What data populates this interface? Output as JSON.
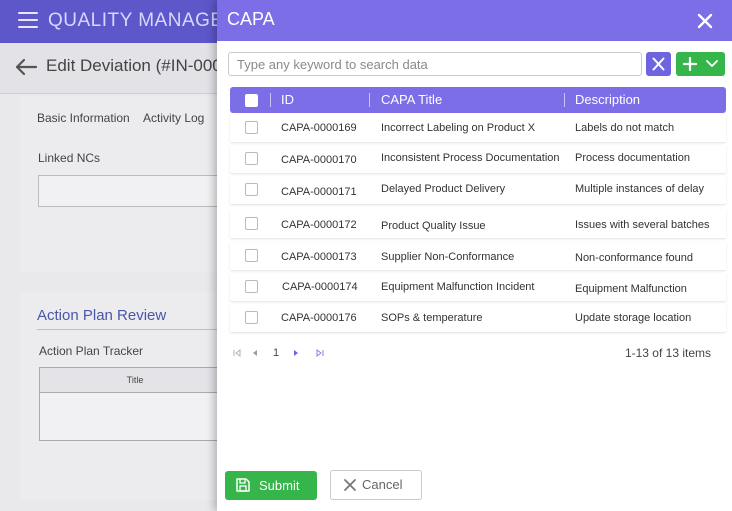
{
  "app": {
    "title": "QUALITY MANAGEMENT"
  },
  "page": {
    "title": "Edit Deviation (#IN-000"
  },
  "tabs": {
    "basic": "Basic Information",
    "activity": "Activity Log"
  },
  "linked_ncs": {
    "label": "Linked NCs"
  },
  "action_plan": {
    "title": "Action Plan Review",
    "tracker_label": "Action Plan Tracker",
    "table_col": "Title"
  },
  "modal": {
    "title": "CAPA",
    "search_placeholder": "Type any keyword to search data",
    "columns": {
      "id": "ID",
      "title": "CAPA Title",
      "description": "Description"
    },
    "rows": [
      {
        "id": "CAPA-0000169",
        "title": "Incorrect Labeling on Product X",
        "description": "Labels do not match"
      },
      {
        "id": "CAPA-0000170",
        "title": "Inconsistent Process Documentation",
        "description": "Process documentation"
      },
      {
        "id": "CAPA-0000171",
        "title": "Delayed Product Delivery",
        "description": "Multiple instances of delay"
      },
      {
        "id": "CAPA-0000172",
        "title": "Product Quality Issue",
        "description": "Issues with several batches"
      },
      {
        "id": "CAPA-0000173",
        "title": "Supplier Non-Conformance",
        "description": "Non-conformance found"
      },
      {
        "id": "CAPA-0000174",
        "title": "Equipment Malfunction Incident",
        "description": "Equipment Malfunction"
      },
      {
        "id": "CAPA-0000176",
        "title": "SOPs & temperature",
        "description": "Update storage location"
      }
    ],
    "pager": {
      "page": "1",
      "info": "1-13 of 13 items"
    },
    "submit_label": "Submit",
    "cancel_label": "Cancel"
  },
  "colors": {
    "primary": "#7b6ee6",
    "topbar": "#5e57c9",
    "success": "#35b54a",
    "link": "#4a56a8"
  },
  "icons": [
    "hamburger-icon",
    "back-arrow-icon",
    "close-icon",
    "clear-icon",
    "plus-icon",
    "chevron-down-icon",
    "first-page-icon",
    "prev-page-icon",
    "next-page-icon",
    "last-page-icon",
    "save-icon"
  ]
}
